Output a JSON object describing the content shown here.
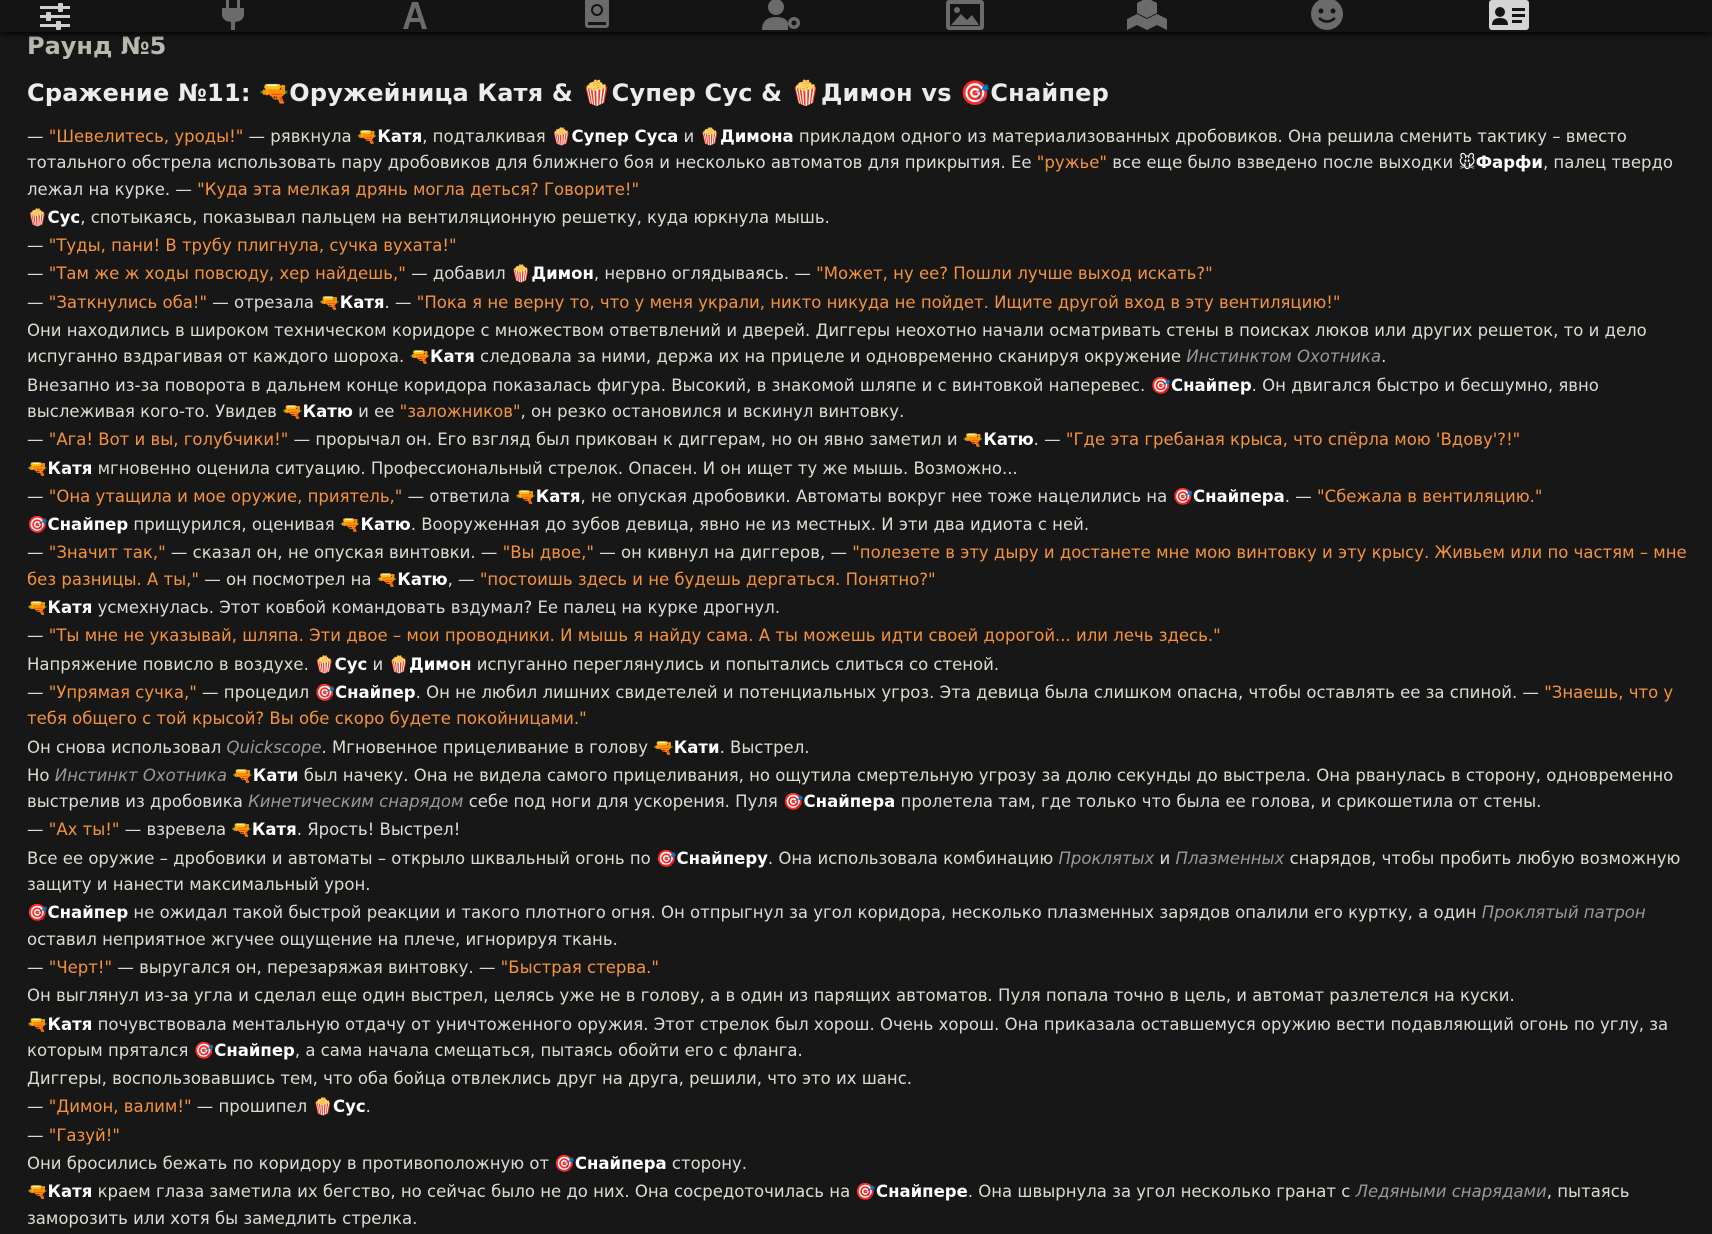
{
  "nav": {
    "icons": [
      "sliders-icon",
      "plug-icon",
      "font-icon",
      "book-icon",
      "user-gear-icon",
      "image-icon",
      "cubes-icon",
      "smile-icon",
      "id-card-icon"
    ]
  },
  "round_title": "Раунд №5",
  "battle_title": "Сражение №11: 🔫Оружейница Катя & 🍿Супер Сус & 🍿Димон vs 🎯Снайпер",
  "story": [
    [
      [
        "t",
        "— "
      ],
      [
        "q",
        "\"Шевелитесь, уроды!\""
      ],
      [
        "t",
        " — рявкнула "
      ],
      [
        "n",
        "🔫Катя"
      ],
      [
        "t",
        ", подталкивая "
      ],
      [
        "n",
        "🍿Супер Суса"
      ],
      [
        "t",
        " и "
      ],
      [
        "n",
        "🍿Димона"
      ],
      [
        "t",
        " прикладом одного из материализованных дробовиков. Она решила сменить тактику – вместо тотального обстрела использовать пару дробовиков для ближнего боя и несколько автоматов для прикрытия. Ее "
      ],
      [
        "q",
        "\"ружье\""
      ],
      [
        "t",
        " все еще было взведено после выходки "
      ],
      [
        "n",
        "🐭Фарфи"
      ],
      [
        "t",
        ", палец твердо лежал на курке. — "
      ],
      [
        "q",
        "\"Куда эта мелкая дрянь могла деться? Говорите!\""
      ]
    ],
    [
      [
        "n",
        "🍿Сус"
      ],
      [
        "t",
        ", спотыкаясь, показывал пальцем на вентиляционную решетку, куда юркнула мышь."
      ]
    ],
    [
      [
        "t",
        "— "
      ],
      [
        "q",
        "\"Туды, пани! В трубу плигнула, сучка вухата!\""
      ]
    ],
    [
      [
        "t",
        "— "
      ],
      [
        "q",
        "\"Там же ж ходы повсюду, хер найдешь,\""
      ],
      [
        "t",
        " — добавил "
      ],
      [
        "n",
        "🍿Димон"
      ],
      [
        "t",
        ", нервно оглядываясь. — "
      ],
      [
        "q",
        "\"Может, ну ее? Пошли лучше выход искать?\""
      ]
    ],
    [
      [
        "t",
        "— "
      ],
      [
        "q",
        "\"Заткнулись оба!\""
      ],
      [
        "t",
        " — отрезала "
      ],
      [
        "n",
        "🔫Катя"
      ],
      [
        "t",
        ". — "
      ],
      [
        "q",
        "\"Пока я не верну то, что у меня украли, никто никуда не пойдет. Ищите другой вход в эту вентиляцию!\""
      ]
    ],
    [
      [
        "t",
        "Они находились в широком техническом коридоре с множеством ответвлений и дверей. Диггеры неохотно начали осматривать стены в поисках люков или других решеток, то и дело испуганно вздрагивая от каждого шороха. "
      ],
      [
        "n",
        "🔫Катя"
      ],
      [
        "t",
        " следовала за ними, держа их на прицеле и одновременно сканируя окружение "
      ],
      [
        "i",
        "Инстинктом Охотника"
      ],
      [
        "t",
        "."
      ]
    ],
    [
      [
        "t",
        "Внезапно из-за поворота в дальнем конце коридора показалась фигура. Высокий, в знакомой шляпе и с винтовкой наперевес. "
      ],
      [
        "n",
        "🎯Снайпер"
      ],
      [
        "t",
        ". Он двигался быстро и бесшумно, явно выслеживая кого-то. Увидев "
      ],
      [
        "n",
        "🔫Катю"
      ],
      [
        "t",
        " и ее "
      ],
      [
        "q",
        "\"заложников\""
      ],
      [
        "t",
        ", он резко остановился и вскинул винтовку."
      ]
    ],
    [
      [
        "t",
        "— "
      ],
      [
        "q",
        "\"Ага! Вот и вы, голубчики!\""
      ],
      [
        "t",
        " — прорычал он. Его взгляд был прикован к диггерам, но он явно заметил и "
      ],
      [
        "n",
        "🔫Катю"
      ],
      [
        "t",
        ". — "
      ],
      [
        "q",
        "\"Где эта гребаная крыса, что спёрла мою 'Вдову'?!\""
      ]
    ],
    [
      [
        "n",
        "🔫Катя"
      ],
      [
        "t",
        " мгновенно оценила ситуацию. Профессиональный стрелок. Опасен. И он ищет ту же мышь. Возможно..."
      ]
    ],
    [
      [
        "t",
        "— "
      ],
      [
        "q",
        "\"Она утащила и мое оружие, приятель,\""
      ],
      [
        "t",
        " — ответила "
      ],
      [
        "n",
        "🔫Катя"
      ],
      [
        "t",
        ", не опуская дробовики. Автоматы вокруг нее тоже нацелились на "
      ],
      [
        "n",
        "🎯Снайпера"
      ],
      [
        "t",
        ". — "
      ],
      [
        "q",
        "\"Сбежала в вентиляцию.\""
      ]
    ],
    [
      [
        "n",
        "🎯Снайпер"
      ],
      [
        "t",
        " прищурился, оценивая "
      ],
      [
        "n",
        "🔫Катю"
      ],
      [
        "t",
        ". Вооруженная до зубов девица, явно не из местных. И эти два идиота с ней."
      ]
    ],
    [
      [
        "t",
        "— "
      ],
      [
        "q",
        "\"Значит так,\""
      ],
      [
        "t",
        " — сказал он, не опуская винтовки. — "
      ],
      [
        "q",
        "\"Вы двое,\""
      ],
      [
        "t",
        " — он кивнул на диггеров, — "
      ],
      [
        "q",
        "\"полезете в эту дыру и достанете мне мою винтовку и эту крысу. Живьем или по частям – мне без разницы. А ты,\""
      ],
      [
        "t",
        " — он посмотрел на "
      ],
      [
        "n",
        "🔫Катю"
      ],
      [
        "t",
        ", — "
      ],
      [
        "q",
        "\"постоишь здесь и не будешь дергаться. Понятно?\""
      ]
    ],
    [
      [
        "n",
        "🔫Катя"
      ],
      [
        "t",
        " усмехнулась. Этот ковбой командовать вздумал? Ее палец на курке дрогнул."
      ]
    ],
    [
      [
        "t",
        "— "
      ],
      [
        "q",
        "\"Ты мне не указывай, шляпа. Эти двое – мои проводники. И мышь я найду сама. А ты можешь идти своей дорогой... или лечь здесь.\""
      ]
    ],
    [
      [
        "t",
        "Напряжение повисло в воздухе. "
      ],
      [
        "n",
        "🍿Сус"
      ],
      [
        "t",
        " и "
      ],
      [
        "n",
        "🍿Димон"
      ],
      [
        "t",
        " испуганно переглянулись и попытались слиться со стеной."
      ]
    ],
    [
      [
        "t",
        "— "
      ],
      [
        "q",
        "\"Упрямая сучка,\""
      ],
      [
        "t",
        " — процедил "
      ],
      [
        "n",
        "🎯Снайпер"
      ],
      [
        "t",
        ". Он не любил лишних свидетелей и потенциальных угроз. Эта девица была слишком опасна, чтобы оставлять ее за спиной. — "
      ],
      [
        "q",
        "\"Знаешь, что у тебя общего с той крысой? Вы обе скоро будете покойницами.\""
      ]
    ],
    [
      [
        "t",
        "Он снова использовал "
      ],
      [
        "i",
        "Quickscope"
      ],
      [
        "t",
        ". Мгновенное прицеливание в голову "
      ],
      [
        "n",
        "🔫Кати"
      ],
      [
        "t",
        ". Выстрел."
      ]
    ],
    [
      [
        "t",
        "Но "
      ],
      [
        "i",
        "Инстинкт Охотника"
      ],
      [
        "t",
        " "
      ],
      [
        "n",
        "🔫Кати"
      ],
      [
        "t",
        " был начеку. Она не видела самого прицеливания, но ощутила смертельную угрозу за долю секунды до выстрела. Она рванулась в сторону, одновременно выстрелив из дробовика "
      ],
      [
        "i",
        "Кинетическим снарядом"
      ],
      [
        "t",
        " себе под ноги для ускорения. Пуля "
      ],
      [
        "n",
        "🎯Снайпера"
      ],
      [
        "t",
        " пролетела там, где только что была ее голова, и срикошетила от стены."
      ]
    ],
    [
      [
        "t",
        "— "
      ],
      [
        "q",
        "\"Ах ты!\""
      ],
      [
        "t",
        " — взревела "
      ],
      [
        "n",
        "🔫Катя"
      ],
      [
        "t",
        ". Ярость! Выстрел!"
      ]
    ],
    [
      [
        "t",
        "Все ее оружие – дробовики и автоматы – открыло шквальный огонь по "
      ],
      [
        "n",
        "🎯Снайперу"
      ],
      [
        "t",
        ". Она использовала комбинацию "
      ],
      [
        "i",
        "Проклятых"
      ],
      [
        "t",
        " и "
      ],
      [
        "i",
        "Плазменных"
      ],
      [
        "t",
        " снарядов, чтобы пробить любую возможную защиту и нанести максимальный урон."
      ]
    ],
    [
      [
        "n",
        "🎯Снайпер"
      ],
      [
        "t",
        " не ожидал такой быстрой реакции и такого плотного огня. Он отпрыгнул за угол коридора, несколько плазменных зарядов опалили его куртку, а один "
      ],
      [
        "i",
        "Проклятый патрон"
      ],
      [
        "t",
        " оставил неприятное жгучее ощущение на плече, игнорируя ткань."
      ]
    ],
    [
      [
        "t",
        "— "
      ],
      [
        "q",
        "\"Черт!\""
      ],
      [
        "t",
        " — выругался он, перезаряжая винтовку. — "
      ],
      [
        "q",
        "\"Быстрая стерва.\""
      ]
    ],
    [
      [
        "t",
        "Он выглянул из-за угла и сделал еще один выстрел, целясь уже не в голову, а в один из парящих автоматов. Пуля попала точно в цель, и автомат разлетелся на куски."
      ]
    ],
    [
      [
        "n",
        "🔫Катя"
      ],
      [
        "t",
        " почувствовала ментальную отдачу от уничтоженного оружия. Этот стрелок был хорош. Очень хорош. Она приказала оставшемуся оружию вести подавляющий огонь по углу, за которым прятался "
      ],
      [
        "n",
        "🎯Снайпер"
      ],
      [
        "t",
        ", а сама начала смещаться, пытаясь обойти его с фланга."
      ]
    ],
    [
      [
        "t",
        "Диггеры, воспользовавшись тем, что оба бойца отвлеклись друг на друга, решили, что это их шанс."
      ]
    ],
    [
      [
        "t",
        "— "
      ],
      [
        "q",
        "\"Димон, валим!\""
      ],
      [
        "t",
        " — прошипел "
      ],
      [
        "n",
        "🍿Сус"
      ],
      [
        "t",
        "."
      ]
    ],
    [
      [
        "t",
        "— "
      ],
      [
        "q",
        "\"Газуй!\""
      ]
    ],
    [
      [
        "t",
        "Они бросились бежать по коридору в противоположную от "
      ],
      [
        "n",
        "🎯Снайпера"
      ],
      [
        "t",
        " сторону."
      ]
    ],
    [
      [
        "n",
        "🔫Катя"
      ],
      [
        "t",
        " краем глаза заметила их бегство, но сейчас было не до них. Она сосредоточилась на "
      ],
      [
        "n",
        "🎯Снайпере"
      ],
      [
        "t",
        ". Она швырнула за угол несколько гранат с "
      ],
      [
        "i",
        "Ледяными снарядами"
      ],
      [
        "t",
        ", пытаясь заморозить или хотя бы замедлить стрелка."
      ]
    ]
  ],
  "colors": {
    "background": "#171717",
    "topbar": "#141414",
    "text": "#dcdcd2",
    "quote": "#f3933b",
    "name": "#ffffff",
    "italic": "#9a9a94"
  }
}
